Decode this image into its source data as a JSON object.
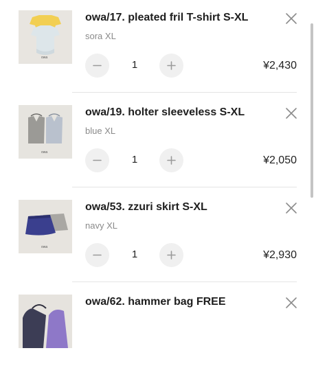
{
  "cart": {
    "items": [
      {
        "name": "owa/17. pleated fril T-shirt S-XL",
        "variant": "sora XL",
        "quantity": "1",
        "price": "¥2,430",
        "thumb_caption": "owa"
      },
      {
        "name": "owa/19. holter sleeveless S-XL",
        "variant": "blue XL",
        "quantity": "1",
        "price": "¥2,050",
        "thumb_caption": "owa"
      },
      {
        "name": "owa/53. zzuri skirt S-XL",
        "variant": "navy XL",
        "quantity": "1",
        "price": "¥2,930",
        "thumb_caption": "owa"
      },
      {
        "name": "owa/62. hammer bag FREE",
        "variant": "",
        "quantity": "",
        "price": "",
        "thumb_caption": ""
      }
    ]
  },
  "icons": {
    "remove": "close-icon",
    "decrease": "minus-icon",
    "increase": "plus-icon"
  },
  "colors": {
    "qty_button_bg": "#f0f0f0",
    "variant_text": "#8a8a8a",
    "divider": "#e4e4e4",
    "scrollbar": "#c4c4c4"
  }
}
